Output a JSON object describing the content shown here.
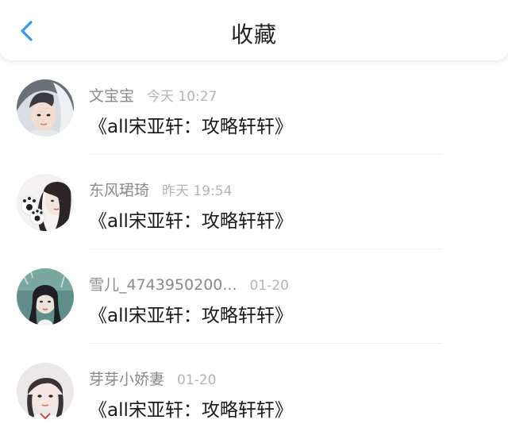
{
  "header": {
    "back_icon": "chevron-left-icon",
    "title": "收藏",
    "accent": "#2f9cf0"
  },
  "favorites": [
    {
      "user": "文宝宝",
      "time": "今天 10:27",
      "title": "《all宋亚轩：攻略轩轩》",
      "avatar": "user-avatar-1"
    },
    {
      "user": "东风珺琦",
      "time": "昨天 19:54",
      "title": "《all宋亚轩：攻略轩轩》",
      "avatar": "user-avatar-2"
    },
    {
      "user": "雪儿_4743950200...",
      "time": "01-20",
      "title": "《all宋亚轩：攻略轩轩》",
      "avatar": "user-avatar-3"
    },
    {
      "user": "芽芽小娇妻",
      "time": "01-20",
      "title": "《all宋亚轩：攻略轩轩》",
      "avatar": "user-avatar-4"
    }
  ]
}
